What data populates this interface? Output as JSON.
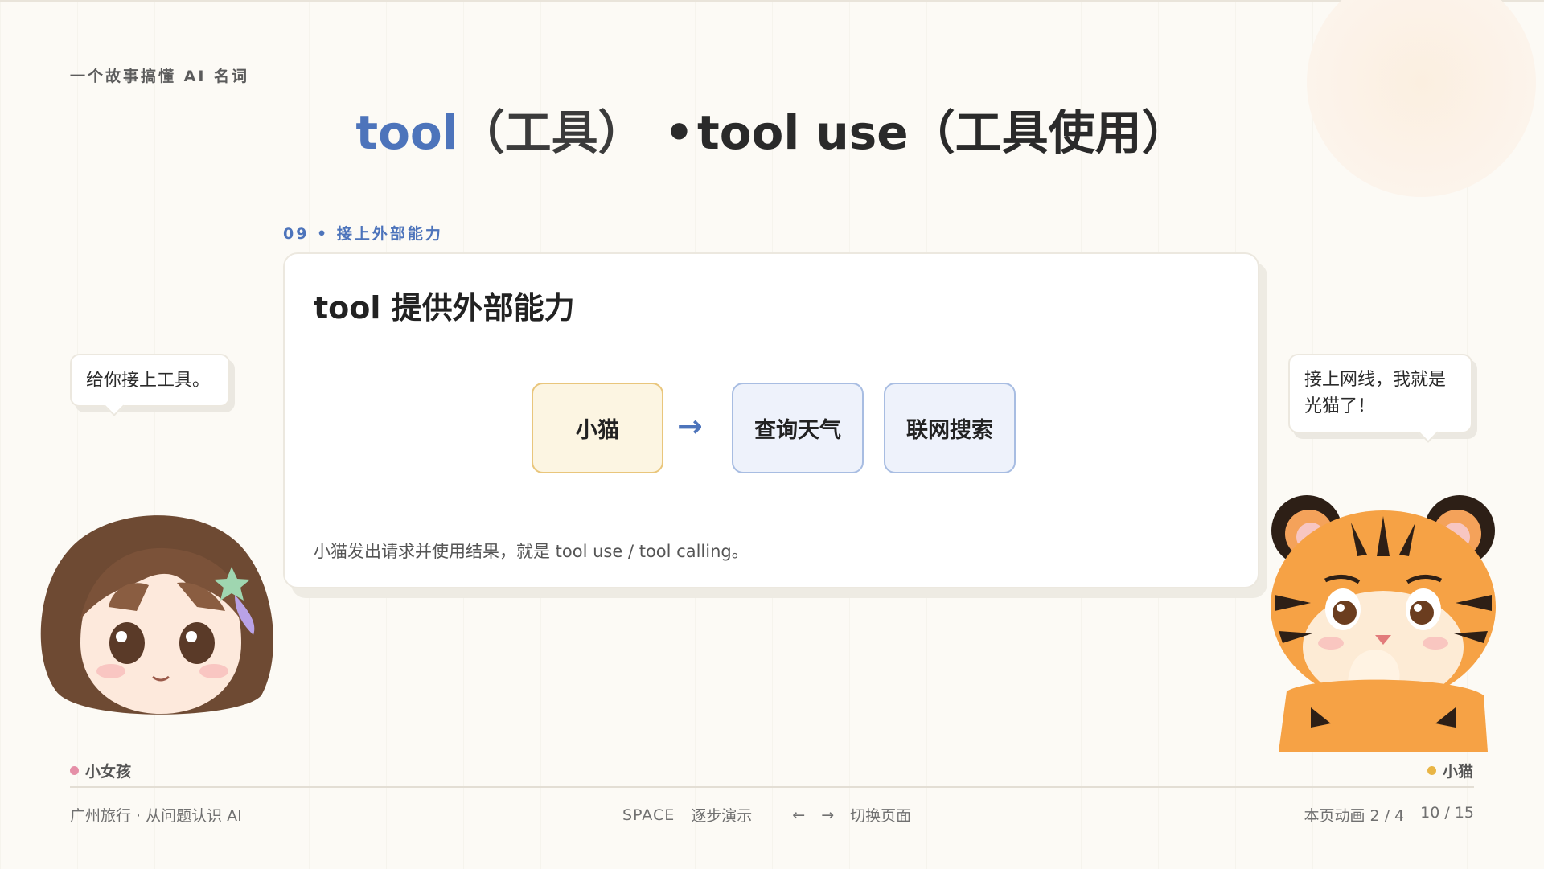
{
  "header": {
    "eyebrow": "一个故事搞懂 AI 名词",
    "title_accent": "tool",
    "title_part1": "（工具）",
    "title_dot": "•",
    "title_part2": "tool use（工具使用）"
  },
  "section": {
    "label": "09 • 接上外部能力"
  },
  "card": {
    "title": "tool 提供外部能力",
    "flow": {
      "nodes": [
        "小猫",
        "查询天气",
        "联网搜索"
      ],
      "arrow": "→"
    },
    "caption": "小猫发出请求并使用结果，就是 tool use / tool calling。"
  },
  "bubbles": {
    "girl": "给你接上工具。",
    "cat_line1": "接上网线，我就是",
    "cat_line2": "光猫了！"
  },
  "characters": {
    "girl_name": "小女孩",
    "cat_name": "小猫",
    "girl_dot_color": "#e58fa7",
    "cat_dot_color": "#e9b545"
  },
  "footer": {
    "left": "广州旅行 · 从问题认识 AI",
    "space_key": "SPACE",
    "space_action": "逐步演示",
    "arrow_left": "←",
    "arrow_right": "→",
    "arrow_action": "切换页面",
    "animation": "本页动画 2 / 4",
    "page": "10 / 15"
  },
  "colors": {
    "accent": "#4d74bb",
    "background": "#fcfaf5",
    "cat_node_fill": "#fcf5e2",
    "tool_node_fill": "#eef2fb"
  }
}
